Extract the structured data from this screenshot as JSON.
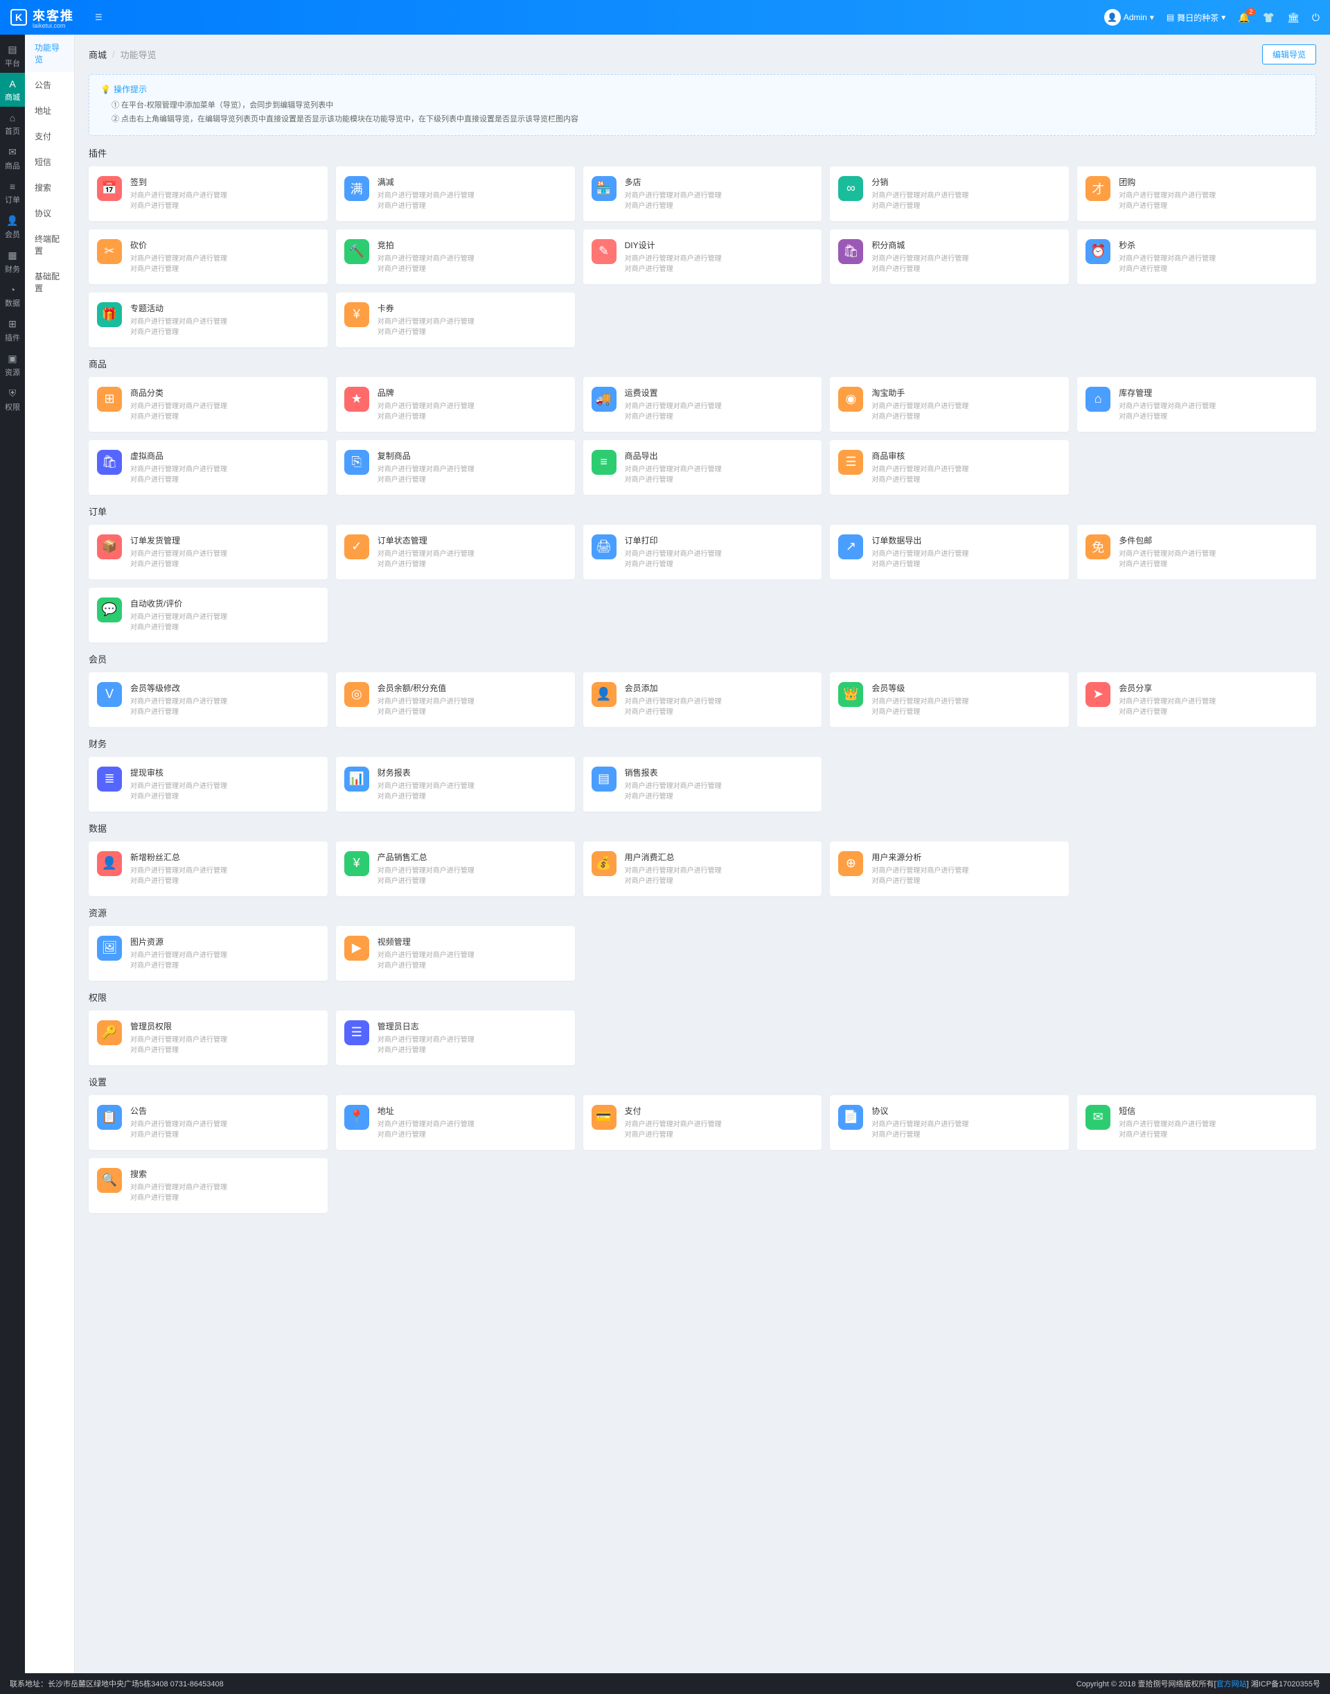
{
  "header": {
    "logo_main": "來客推",
    "logo_sub": "laiketui.com",
    "admin_name": "Admin",
    "shop_link": "舞日的种茶",
    "notification_count": "2"
  },
  "sidebar_primary": [
    {
      "icon": "▤",
      "label": "平台",
      "name": "platform"
    },
    {
      "icon": "A",
      "label": "商城",
      "name": "mall",
      "active": true
    },
    {
      "icon": "⌂",
      "label": "首页",
      "name": "home"
    },
    {
      "icon": "✉",
      "label": "商品",
      "name": "goods"
    },
    {
      "icon": "≡",
      "label": "订单",
      "name": "orders"
    },
    {
      "icon": "👤",
      "label": "会员",
      "name": "members"
    },
    {
      "icon": "▦",
      "label": "财务",
      "name": "finance"
    },
    {
      "icon": "◔",
      "label": "数据",
      "name": "data"
    },
    {
      "icon": "⊞",
      "label": "插件",
      "name": "plugins"
    },
    {
      "icon": "▣",
      "label": "资源",
      "name": "resources"
    },
    {
      "icon": "⛨",
      "label": "权限",
      "name": "permissions"
    }
  ],
  "sidebar_secondary": [
    {
      "label": "功能导览",
      "active": true
    },
    {
      "label": "公告"
    },
    {
      "label": "地址"
    },
    {
      "label": "支付"
    },
    {
      "label": "短信"
    },
    {
      "label": "搜索"
    },
    {
      "label": "协议"
    },
    {
      "label": "终端配置"
    },
    {
      "label": "基础配置"
    }
  ],
  "breadcrumb": {
    "primary": "商城",
    "secondary": "功能导览",
    "edit_btn": "编辑导览"
  },
  "notice": {
    "title": "操作提示",
    "lines": [
      "① 在平台-权限管理中添加菜单（导览），会同步到编辑导览列表中",
      "② 点击右上角编辑导览，在编辑导览列表页中直接设置是否显示该功能模块在功能导览中，在下级列表中直接设置是否显示该导览栏图内容"
    ]
  },
  "sections": [
    {
      "title": "插件",
      "items": [
        {
          "title": "签到",
          "color": "c-red",
          "icon": "📅"
        },
        {
          "title": "满减",
          "color": "c-blue",
          "icon": "满"
        },
        {
          "title": "多店",
          "color": "c-blue",
          "icon": "🏪"
        },
        {
          "title": "分销",
          "color": "c-cyan",
          "icon": "∞"
        },
        {
          "title": "团购",
          "color": "c-orange",
          "icon": "才"
        },
        {
          "title": "砍价",
          "color": "c-orange",
          "icon": "✂"
        },
        {
          "title": "竞拍",
          "color": "c-green",
          "icon": "🔨"
        },
        {
          "title": "DIY设计",
          "color": "c-pink",
          "icon": "✎"
        },
        {
          "title": "积分商城",
          "color": "c-purple",
          "icon": "🛍"
        },
        {
          "title": "秒杀",
          "color": "c-blue",
          "icon": "⏰"
        },
        {
          "title": "专题活动",
          "color": "c-cyan",
          "icon": "🎁"
        },
        {
          "title": "卡券",
          "color": "c-orange",
          "icon": "¥"
        }
      ]
    },
    {
      "title": "商品",
      "items": [
        {
          "title": "商品分类",
          "color": "c-orange",
          "icon": "⊞"
        },
        {
          "title": "品牌",
          "color": "c-red",
          "icon": "★"
        },
        {
          "title": "运费设置",
          "color": "c-blue",
          "icon": "🚚"
        },
        {
          "title": "淘宝助手",
          "color": "c-orange",
          "icon": "◉"
        },
        {
          "title": "库存管理",
          "color": "c-blue",
          "icon": "⌂"
        },
        {
          "title": "虚拟商品",
          "color": "c-indigo",
          "icon": "🛍"
        },
        {
          "title": "复制商品",
          "color": "c-blue",
          "icon": "⎘"
        },
        {
          "title": "商品导出",
          "color": "c-green",
          "icon": "≡"
        },
        {
          "title": "商品审核",
          "color": "c-orange",
          "icon": "☰"
        }
      ]
    },
    {
      "title": "订单",
      "items": [
        {
          "title": "订单发货管理",
          "color": "c-red",
          "icon": "📦"
        },
        {
          "title": "订单状态管理",
          "color": "c-orange",
          "icon": "✓"
        },
        {
          "title": "订单打印",
          "color": "c-blue",
          "icon": "🖨"
        },
        {
          "title": "订单数据导出",
          "color": "c-blue",
          "icon": "↗"
        },
        {
          "title": "多件包邮",
          "color": "c-orange",
          "icon": "免"
        },
        {
          "title": "自动收货/评价",
          "color": "c-green",
          "icon": "💬"
        }
      ]
    },
    {
      "title": "会员",
      "items": [
        {
          "title": "会员等级修改",
          "color": "c-blue",
          "icon": "V"
        },
        {
          "title": "会员余额/积分充值",
          "color": "c-orange",
          "icon": "◎"
        },
        {
          "title": "会员添加",
          "color": "c-orange",
          "icon": "👤"
        },
        {
          "title": "会员等级",
          "color": "c-green",
          "icon": "👑"
        },
        {
          "title": "会员分享",
          "color": "c-red",
          "icon": "➤"
        }
      ]
    },
    {
      "title": "财务",
      "items": [
        {
          "title": "提现审核",
          "color": "c-indigo",
          "icon": "≣"
        },
        {
          "title": "财务报表",
          "color": "c-blue",
          "icon": "📊"
        },
        {
          "title": "销售报表",
          "color": "c-blue",
          "icon": "▤"
        }
      ]
    },
    {
      "title": "数据",
      "items": [
        {
          "title": "新增粉丝汇总",
          "color": "c-red",
          "icon": "👤"
        },
        {
          "title": "产品销售汇总",
          "color": "c-green",
          "icon": "¥"
        },
        {
          "title": "用户消费汇总",
          "color": "c-orange",
          "icon": "💰"
        },
        {
          "title": "用户来源分析",
          "color": "c-orange",
          "icon": "⊕"
        }
      ]
    },
    {
      "title": "资源",
      "items": [
        {
          "title": "图片资源",
          "color": "c-blue",
          "icon": "🖼"
        },
        {
          "title": "视频管理",
          "color": "c-orange",
          "icon": "▶"
        }
      ]
    },
    {
      "title": "权限",
      "items": [
        {
          "title": "管理员权限",
          "color": "c-orange",
          "icon": "🔑"
        },
        {
          "title": "管理员日志",
          "color": "c-indigo",
          "icon": "☰"
        }
      ]
    },
    {
      "title": "设置",
      "items": [
        {
          "title": "公告",
          "color": "c-blue",
          "icon": "📋"
        },
        {
          "title": "地址",
          "color": "c-blue",
          "icon": "📍"
        },
        {
          "title": "支付",
          "color": "c-orange",
          "icon": "💳"
        },
        {
          "title": "协议",
          "color": "c-blue",
          "icon": "📄"
        },
        {
          "title": "短信",
          "color": "c-green",
          "icon": "✉"
        },
        {
          "title": "搜索",
          "color": "c-orange",
          "icon": "🔍"
        }
      ]
    }
  ],
  "card_desc": {
    "line1": "对商户进行管理对商户进行管理",
    "line2": "对商户进行管理"
  },
  "footer": {
    "left": "联系地址：长沙市岳麓区绿地中央广场5栋3408 0731-86453408",
    "right_prefix": "Copyright © 2018 壹拾捌号网络版权所有[",
    "right_link": "官方网站",
    "right_suffix": "]   湘ICP备17020355号"
  }
}
